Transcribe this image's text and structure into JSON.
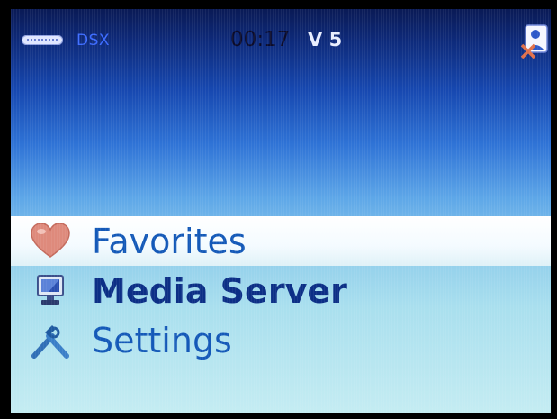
{
  "status_bar": {
    "network_label": "DSX",
    "clock": "00:17",
    "volume": "V 5"
  },
  "menu": {
    "items": [
      {
        "label": "Favorites",
        "icon": "heart-icon",
        "selected": true
      },
      {
        "label": "Media Server",
        "icon": "monitor-icon",
        "selected": false
      },
      {
        "label": "Settings",
        "icon": "tools-icon",
        "selected": false
      }
    ]
  },
  "colors": {
    "label_blue": "#1459b8",
    "label_dark_blue": "#0c2f86",
    "status_text": "#3c6bff"
  }
}
